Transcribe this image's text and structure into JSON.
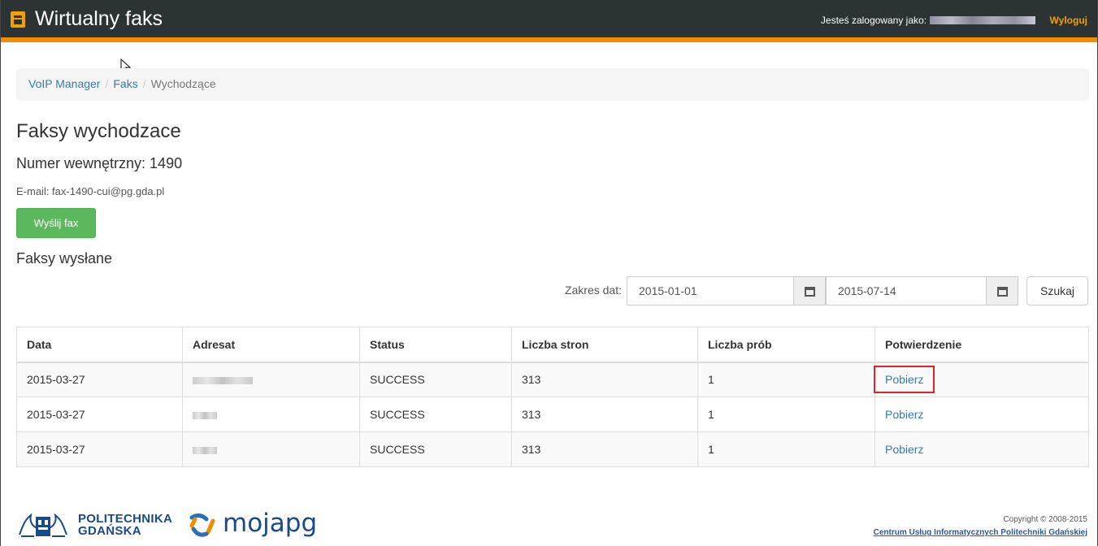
{
  "header": {
    "app_title": "Wirtualny faks",
    "logged_in_label": "Jesteś zalogowany jako:",
    "logout_label": "Wyloguj"
  },
  "breadcrumb": {
    "items": [
      "VoIP Manager",
      "Faks",
      "Wychodzące"
    ],
    "separator": "/"
  },
  "main": {
    "title": "Faksy wychodzace",
    "extension_label": "Numer wewnętrzny: 1490",
    "email_label": "E-mail: fax-1490-cui@pg.gda.pl",
    "send_button": "Wyślij fax",
    "sent_heading": "Faksy wysłane"
  },
  "filter": {
    "range_label": "Zakres dat:",
    "date_from": "2015-01-01",
    "date_to": "2015-07-14",
    "search_button": "Szukaj"
  },
  "table": {
    "columns": [
      "Data",
      "Adresat",
      "Status",
      "Liczba stron",
      "Liczba prób",
      "Potwierdzenie"
    ],
    "rows": [
      {
        "date": "2015-03-27",
        "status": "SUCCESS",
        "pages": "313",
        "attempts": "1",
        "confirmation": "Pobierz"
      },
      {
        "date": "2015-03-27",
        "status": "SUCCESS",
        "pages": "313",
        "attempts": "1",
        "confirmation": "Pobierz"
      },
      {
        "date": "2015-03-27",
        "status": "SUCCESS",
        "pages": "313",
        "attempts": "1",
        "confirmation": "Pobierz"
      }
    ]
  },
  "footer": {
    "pg_logo_line1": "POLITECHNIKA",
    "pg_logo_line2": "GDAŃSKA",
    "mojapg_logo": "mojapg",
    "copyright": "Copyright © 2008-2015",
    "cui": "Centrum Usług Informatycznych Politechniki Gdańskiej"
  },
  "colors": {
    "navbar": "#2b3335",
    "accent": "#f28c00",
    "success": "#5cb85c",
    "link": "#337ab7",
    "highlight": "#e0202a"
  }
}
